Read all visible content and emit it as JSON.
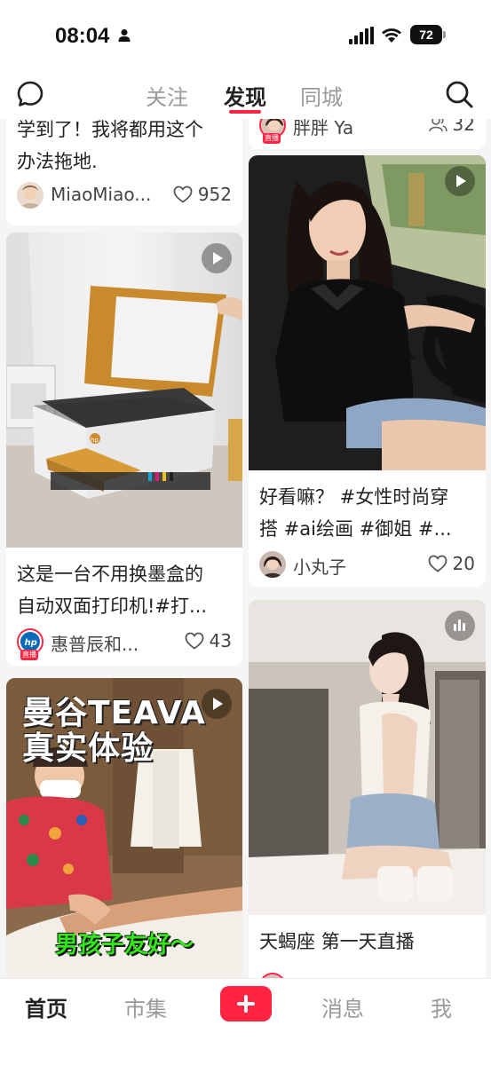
{
  "status_bar": {
    "time": "08:04",
    "battery": "72"
  },
  "top_nav": {
    "tabs": [
      {
        "label": "关注"
      },
      {
        "label": "发现"
      },
      {
        "label": "同城"
      }
    ]
  },
  "feed": {
    "left": [
      {
        "caption_lines": [
          "学到了！我将都用这个",
          "办法拖地."
        ],
        "author": "MiaoMiao...",
        "likes": "952"
      },
      {
        "caption_lines": [
          "这是一台不用换墨盒的",
          "自动双面打印机!#打..."
        ],
        "author": "惠普辰和...",
        "likes": "43",
        "live_tag": "直播",
        "image_label": "hp"
      },
      {
        "overlay_lines": [
          "曼谷TEAVA",
          "真实体验"
        ],
        "overlay_bottom": "男孩子友好～"
      }
    ],
    "right": [
      {
        "author": "胖胖 Ya",
        "count": "32",
        "live_tag": "直播"
      },
      {
        "caption_lines": [
          "好看嘛？ #女性时尚穿",
          "搭 #ai绘画 #御姐 #..."
        ],
        "author": "小丸子",
        "likes": "20"
      },
      {
        "caption_lines": [
          "天蝎座 第一天直播"
        ]
      }
    ]
  },
  "bottom_nav": {
    "home": "首页",
    "market": "市集",
    "messages": "消息",
    "me": "我"
  },
  "colors": {
    "accent": "#ff2442",
    "overlay_green": "#31e61a"
  }
}
